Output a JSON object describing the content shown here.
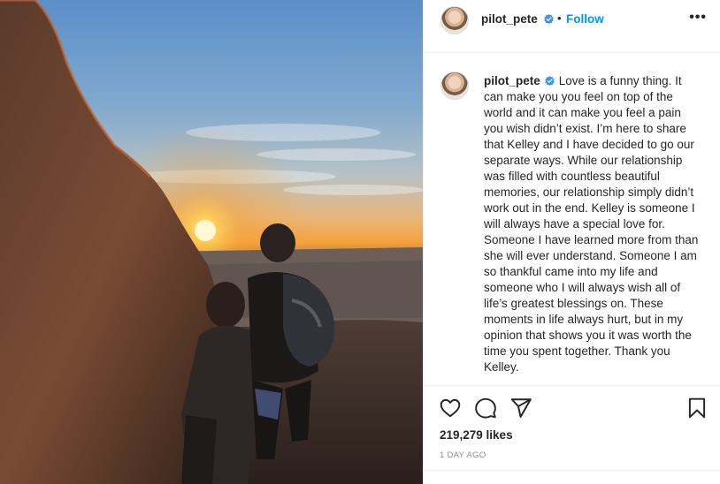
{
  "post": {
    "username": "pilot_pete",
    "separator": "•",
    "follow_label": "Follow",
    "more_label": "•••",
    "caption": "Love is a funny thing. It can make you you feel on top of the world and it can make you feel a pain you wish didn’t exist. I’m here to share that Kelley and I have decided to go our separate ways. While our relationship was filled with countless beautiful memories, our relationship simply didn’t work out in the end. Kelley is someone I will always have a special love for. Someone I have learned more from than she will ever understand. Someone I am so thankful came into my life and someone who I will always wish all of life’s greatest blessings on. These moments in life always hurt, but in my opinion that shows you it was worth the time you spent together. Thank you Kelley.",
    "likes": "219,279 likes",
    "timestamp": "1 DAY AGO"
  },
  "icons": {
    "verified": "verified-badge-icon",
    "like": "heart-icon",
    "comment": "comment-icon",
    "share": "paper-plane-icon",
    "save": "bookmark-icon",
    "more": "more-options-icon"
  },
  "colors": {
    "accent": "#0095f6",
    "verified": "#3897f0",
    "text": "#262626",
    "muted": "#8e8e8e",
    "border": "#efefef"
  }
}
